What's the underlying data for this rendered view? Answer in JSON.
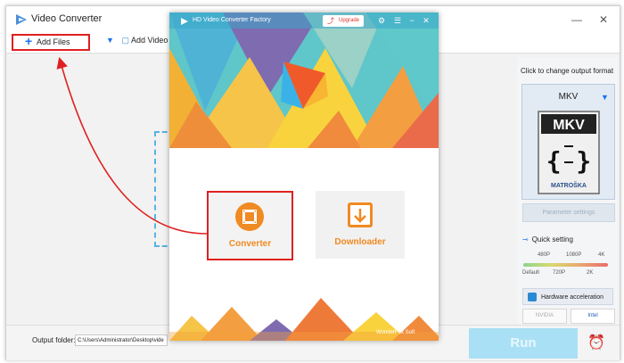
{
  "main_window": {
    "title": "Video Converter",
    "window_controls": [
      "—",
      "✕"
    ],
    "toolbar": {
      "add_files_label": "Add Files",
      "add_video_folder_label": "Add Video F"
    }
  },
  "right_panel": {
    "format_hint": "Click to change output format",
    "format_name": "MKV",
    "format_icon_label": "MKV",
    "format_icon_brand": "MATROŠKA",
    "parameter_settings_label": "Parameter settings",
    "quick_setting_label": "Quick setting",
    "quality_ticks_top": [
      "480P",
      "1080P",
      "4K"
    ],
    "quality_ticks_bottom": [
      "Default",
      "720P",
      "2K"
    ],
    "hardware_acceleration_label": "Hardware acceleration",
    "nvidia_label": "NVIDIA",
    "intel_label": "Intel"
  },
  "bottom_bar": {
    "output_folder_label": "Output folder:",
    "output_folder_value": "C:\\Users\\Administrator\\Desktop\\vide",
    "run_label": "Run"
  },
  "hub": {
    "title": "HD Video Converter Factory",
    "upgrade_label": "Upgrade",
    "tiles": {
      "converter_label": "Converter",
      "downloader_label": "Downloader"
    },
    "footer_brand": "WonderFox Soft"
  },
  "colors": {
    "accent_blue": "#1a73e8",
    "highlight_red": "#e02020",
    "tile_orange": "#f08a22",
    "run_button": "#a9e0f5"
  },
  "icons": [
    "app-logo-icon",
    "plus-icon",
    "folder-icon",
    "minimize-icon",
    "close-icon",
    "mkv-format-icon",
    "settings-icon",
    "menu-icon",
    "film-icon",
    "download-icon",
    "alarm-clock-icon"
  ]
}
